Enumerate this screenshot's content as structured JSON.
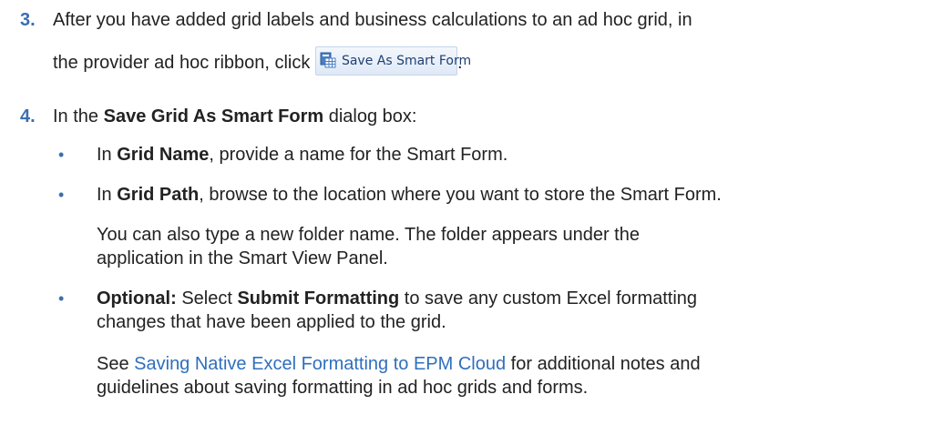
{
  "step3": {
    "number": "3.",
    "line1": "After you have added grid labels and business calculations to an ad hoc grid, in",
    "line2_pre": "the provider ad hoc ribbon, click",
    "button_label": "Save As Smart Form",
    "button_icon": "grid-form-icon",
    "line2_post": "."
  },
  "step4": {
    "number": "4.",
    "pre": "In the ",
    "bold": "Save Grid As Smart Form",
    "post": " dialog box:",
    "bullets": [
      {
        "pre": "In ",
        "bold": "Grid Name",
        "post": ", provide a name for the Smart Form."
      },
      {
        "pre": "In ",
        "bold": "Grid Path",
        "post": ", browse to the location where you want to store the Smart Form."
      },
      {
        "bold": "Optional:",
        "mid": " Select ",
        "bold2": "Submit Formatting",
        "post": " to save any custom Excel formatting"
      }
    ],
    "bullet2_para": [
      "You can also type a new folder name. The folder appears under the",
      "application in the Smart View Panel."
    ],
    "bullet3_line2": "changes that have been applied to the grid.",
    "see": {
      "pre": "See ",
      "link": "Saving Native Excel Formatting to EPM Cloud",
      "post": " for additional notes and",
      "line2": "guidelines about saving formatting in ad hoc grids and forms."
    }
  },
  "colors": {
    "accent": "#3a6fb0",
    "link": "#2f6fbd"
  }
}
